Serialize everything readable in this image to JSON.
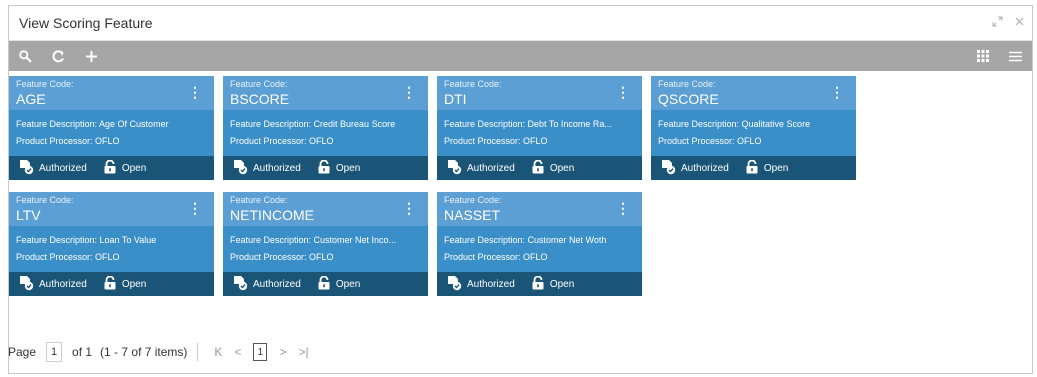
{
  "window": {
    "title": "View Scoring Feature"
  },
  "cards": [
    {
      "label": "Feature Code:",
      "code": "AGE",
      "desc": "Feature Description: Age Of Customer",
      "processor": "Product Processor: OFLO",
      "status": "Authorized",
      "lock": "Open"
    },
    {
      "label": "Feature Code:",
      "code": "BSCORE",
      "desc": "Feature Description: Credit Bureau Score",
      "processor": "Product Processor: OFLO",
      "status": "Authorized",
      "lock": "Open"
    },
    {
      "label": "Feature Code:",
      "code": "DTI",
      "desc": "Feature Description: Debt To Income Ra...",
      "processor": "Product Processor: OFLO",
      "status": "Authorized",
      "lock": "Open"
    },
    {
      "label": "Feature Code:",
      "code": "QSCORE",
      "desc": "Feature Description: Qualitative Score",
      "processor": "Product Processor: OFLO",
      "status": "Authorized",
      "lock": "Open"
    },
    {
      "label": "Feature Code:",
      "code": "LTV",
      "desc": "Feature Description: Loan To Value",
      "processor": "Product Processor: OFLO",
      "status": "Authorized",
      "lock": "Open"
    },
    {
      "label": "Feature Code:",
      "code": "NETINCOME",
      "desc": "Feature Description: Customer Net Inco...",
      "processor": "Product Processor: OFLO",
      "status": "Authorized",
      "lock": "Open"
    },
    {
      "label": "Feature Code:",
      "code": "NASSET",
      "desc": "Feature Description: Customer Net Woth",
      "processor": "Product Processor: OFLO",
      "status": "Authorized",
      "lock": "Open"
    }
  ],
  "pager": {
    "label": "Page",
    "page_input": "1",
    "of": "of 1",
    "items": "(1 - 7 of 7 items)",
    "current": "1"
  }
}
